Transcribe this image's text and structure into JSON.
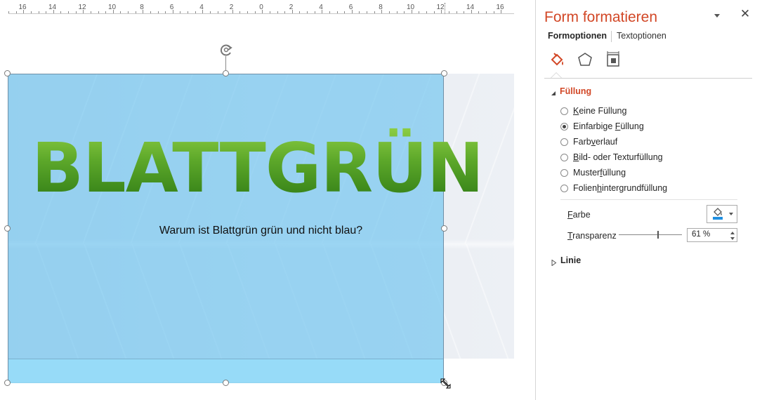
{
  "ruler": {
    "labels": [
      "16",
      "14",
      "12",
      "10",
      "8",
      "6",
      "4",
      "2",
      "0",
      "2",
      "4",
      "6",
      "8",
      "10",
      "12",
      "14",
      "16"
    ]
  },
  "slide": {
    "title": "BLATTGRÜN",
    "subtitle": "Warum ist Blattgrün grün und nicht blau?"
  },
  "panel": {
    "title": "Form formatieren",
    "tabs": {
      "shape": "Formoptionen",
      "text": "Textoptionen"
    },
    "categories": [
      "fill-and-line-icon",
      "effects-icon",
      "size-and-properties-icon"
    ],
    "fill_section": {
      "heading": "Füllung",
      "options": [
        {
          "pre": "",
          "u": "K",
          "post": "eine Füllung",
          "checked": false
        },
        {
          "pre": "Einfarbige ",
          "u": "F",
          "post": "üllung",
          "checked": true
        },
        {
          "pre": "Farb",
          "u": "v",
          "post": "erlauf",
          "checked": false
        },
        {
          "pre": "",
          "u": "B",
          "post": "ild- oder Texturfüllung",
          "checked": false
        },
        {
          "pre": "Muster",
          "u": "f",
          "post": "üllung",
          "checked": false
        },
        {
          "pre": "Folien",
          "u": "h",
          "post": "intergrundfüllung",
          "checked": false
        }
      ],
      "color_label_u": "F",
      "color_label_rest": "arbe",
      "transparency_label_u": "T",
      "transparency_label_rest": "ransparenz",
      "transparency_value": "61 %",
      "transparency_level": 0.61,
      "fill_color": "#1f8fe0"
    },
    "line_section": {
      "heading": "Linie"
    }
  },
  "colors": {
    "accent": "#d24726",
    "overlay": "#78c8f0",
    "leaf_green": "#5fa52c"
  }
}
